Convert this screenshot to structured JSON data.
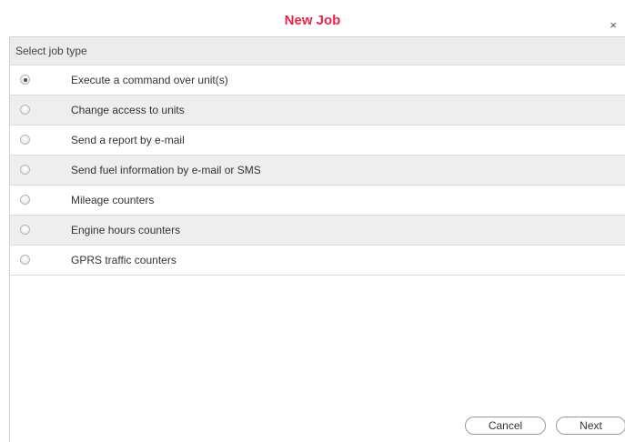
{
  "dialog": {
    "title": "New Job",
    "close_label": "×",
    "title_color": "#e8264a"
  },
  "job_types": {
    "header": "Select job type",
    "selected_index": 0,
    "items": [
      {
        "label": "Execute a command over unit(s)",
        "checked": true
      },
      {
        "label": "Change access to units",
        "checked": false
      },
      {
        "label": "Send a report by e-mail",
        "checked": false
      },
      {
        "label": "Send fuel information by e-mail or SMS",
        "checked": false
      },
      {
        "label": "Mileage counters",
        "checked": false
      },
      {
        "label": "Engine hours counters",
        "checked": false
      },
      {
        "label": "GPRS traffic counters",
        "checked": false
      }
    ]
  },
  "footer": {
    "cancel_label": "Cancel",
    "next_label": "Next"
  }
}
